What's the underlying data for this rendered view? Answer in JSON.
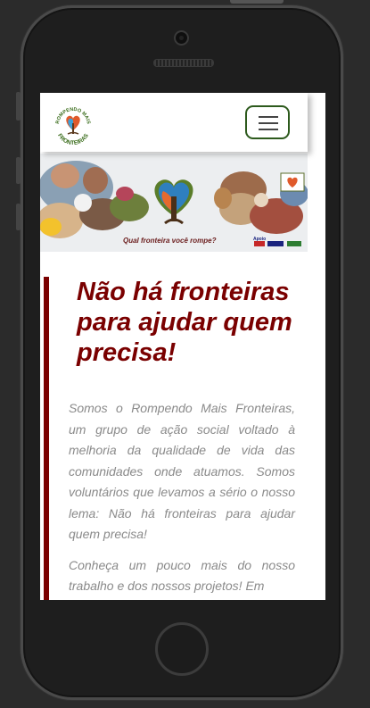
{
  "site": {
    "logo_text_top": "ROMPENDO MAIS",
    "logo_text_bottom": "FRONTEIRAS",
    "menu_button_label": "Toggle navigation"
  },
  "banner": {
    "caption": "Qual fronteira você rompe?",
    "partners": "Apoio"
  },
  "main": {
    "headline": "Não há fronteiras para ajudar quem precisa!",
    "paragraphs": [
      "Somos o Rompendo Mais Fronteiras, um grupo de ação social voltado à melhoria da qualidade de vida das comunidades onde atuamos. Somos voluntários que levamos a sério o nosso lema: Não há fronteiras para ajudar quem precisa!",
      "Conheça um pouco mais do nosso trabalho e dos nossos projetos! Em"
    ]
  },
  "colors": {
    "accent": "#7a0000",
    "menu_border": "#2d5a1d",
    "body_text": "#8a8a8a",
    "device_bg": "#2b2b2b"
  },
  "icons": {
    "menu": "hamburger-icon",
    "logo": "tree-heart-logo",
    "camera": "front-camera-icon",
    "home": "home-button"
  }
}
